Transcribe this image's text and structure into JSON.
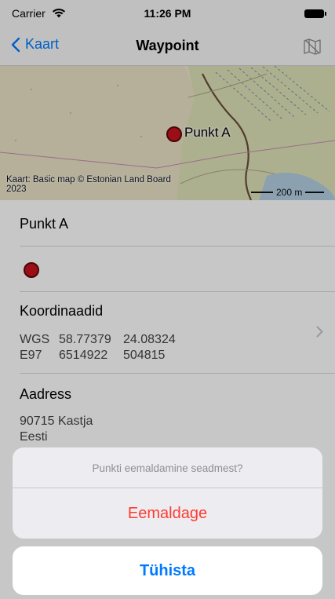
{
  "status_bar": {
    "carrier": "Carrier",
    "time": "11:26 PM"
  },
  "nav": {
    "back_label": "Kaart",
    "title": "Waypoint",
    "right_icon": "map-icon"
  },
  "map": {
    "marker_label": "Punkt A",
    "attribution": "Kaart: Basic map © Estonian Land Board 2023",
    "scale_label": "200 m"
  },
  "waypoint": {
    "name": "Punkt A",
    "color": "#c8121b",
    "coordinates_label": "Koordinaadid",
    "coords": [
      {
        "system": "WGS",
        "v1": "58.77379",
        "v2": "24.08324"
      },
      {
        "system": "E97",
        "v1": "6514922",
        "v2": "504815"
      }
    ],
    "address_label": "Aadress",
    "address_lines": [
      "90715 Kastja",
      "Eesti"
    ]
  },
  "action_sheet": {
    "title": "Punkti eemaldamine seadmest?",
    "destructive_label": "Eemaldage",
    "cancel_label": "Tühista"
  },
  "colors": {
    "accent": "#007aff",
    "destructive": "#ff3b30"
  }
}
